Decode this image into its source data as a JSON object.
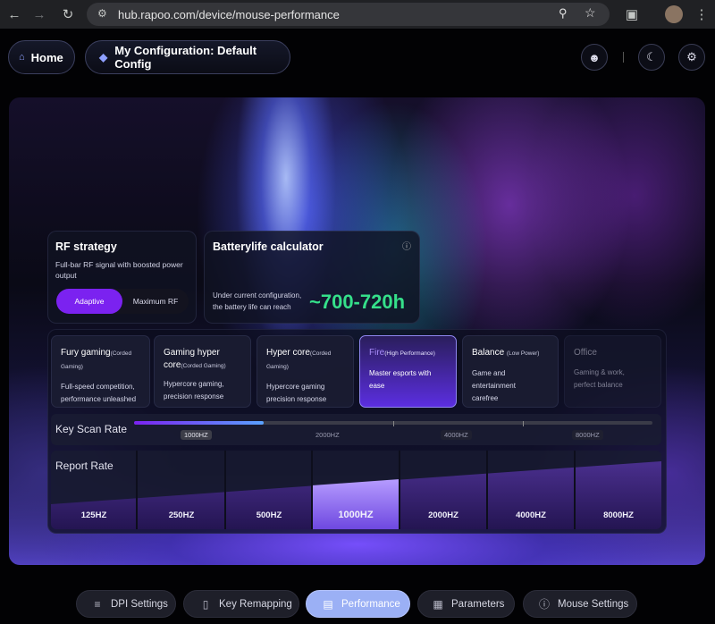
{
  "browser": {
    "url": "hub.rapoo.com/device/mouse-performance"
  },
  "header": {
    "home_label": "Home",
    "config_label": "My Configuration: Default Config"
  },
  "rf_strategy": {
    "title": "RF strategy",
    "description": "Full-bar RF signal with boosted power output",
    "options": [
      "Adaptive",
      "Maximum RF"
    ],
    "selected": "Adaptive"
  },
  "battery": {
    "title": "Batterylife calculator",
    "caption_line1": "Under current configuration,",
    "caption_line2": "the battery life can reach",
    "value": "~700-720h"
  },
  "modes": [
    {
      "title": "Fury gaming",
      "sub": "(Corded Gaming)",
      "desc1": "Full-speed competition,",
      "desc2": "performance unleashed"
    },
    {
      "title": "Gaming hyper core",
      "sub": "(Corded Gaming)",
      "desc1": "Hypercore gaming,",
      "desc2": "precision response"
    },
    {
      "title": "Hyper core",
      "sub": "(Corded Gaming)",
      "desc1": "Hypercore gaming",
      "desc2": "precision response"
    },
    {
      "title": "Fire",
      "sub": "(High Performance)",
      "desc1": "Master esports with",
      "desc2": "ease"
    },
    {
      "title": "Balance ",
      "sub": "(Low Power)",
      "desc1": "Game and entertainment",
      "desc2": "carefree"
    },
    {
      "title": "Office",
      "sub": "",
      "desc1": "Gaming & work,",
      "desc2": "perfect balance"
    }
  ],
  "key_scan": {
    "label": "Key Scan Rate",
    "ticks": [
      "1000HZ",
      "2000HZ",
      "4000HZ",
      "8000HZ"
    ],
    "selected": "1000HZ",
    "level": 0.25
  },
  "report_rate": {
    "label": "Report Rate",
    "options": [
      "125HZ",
      "250HZ",
      "500HZ",
      "1000HZ",
      "2000HZ",
      "4000HZ",
      "8000HZ"
    ],
    "selected": "1000HZ"
  },
  "bottom_nav": {
    "items": [
      "DPI Settings",
      "Key Remapping",
      "Performance",
      "Parameters",
      "Mouse Settings"
    ],
    "active": "Performance"
  },
  "colors": {
    "accent": "#7c3aed",
    "battery_green": "#35e08a",
    "active_tab": "#9bb0f5"
  }
}
